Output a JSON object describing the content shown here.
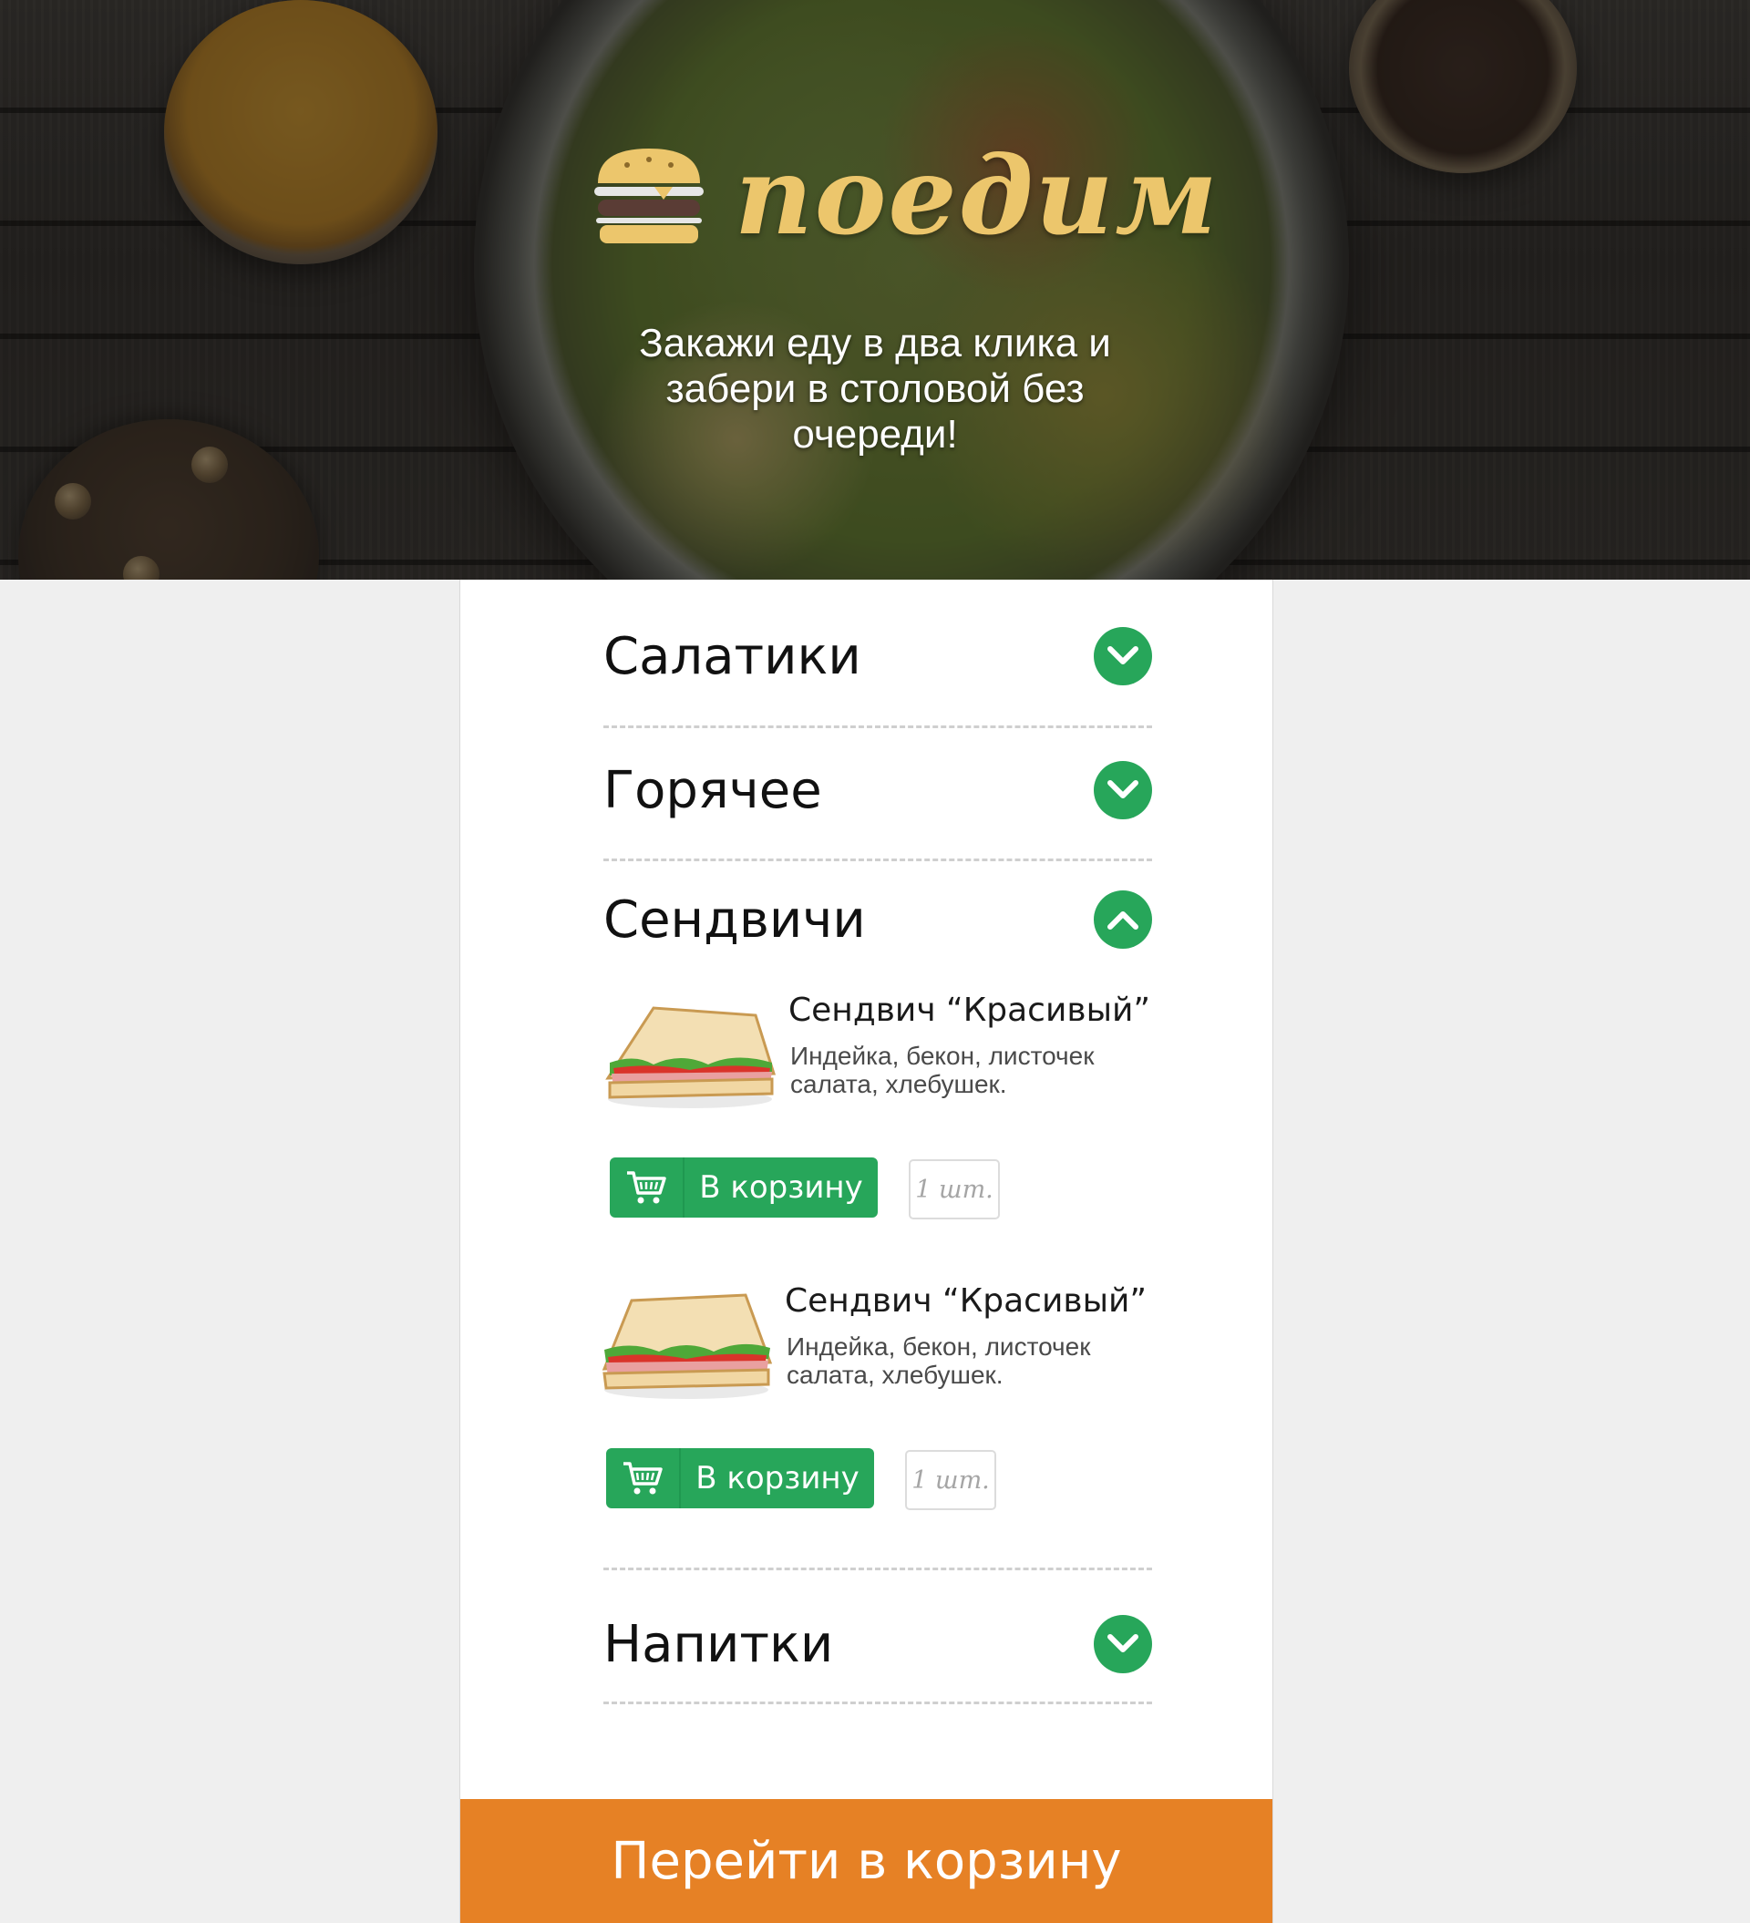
{
  "header": {
    "brand": "поедим",
    "tagline": "Закажи еду в два клика и забери в столовой без очереди!"
  },
  "menu": {
    "categories": [
      {
        "label": "Салатики",
        "state": "collapsed"
      },
      {
        "label": "Горячее",
        "state": "collapsed"
      },
      {
        "label": "Сендвичи",
        "state": "expanded"
      },
      {
        "label": "Напитки",
        "state": "collapsed"
      }
    ],
    "items": [
      {
        "title": "Сендвич “Красивый”",
        "description": "Индейка, бекон, листочек салата, хлебушек.",
        "add_label": "В корзину",
        "qty_placeholder": "1 шт."
      },
      {
        "title": "Сендвич “Красивый”",
        "description": "Индейка, бекон, листочек салата, хлебушек.",
        "add_label": "В корзину",
        "qty_placeholder": "1 шт."
      }
    ]
  },
  "footer": {
    "checkout_label": "Перейти в корзину"
  },
  "colors": {
    "accent_green": "#27a65a",
    "checkout_orange": "#e68125",
    "logo_yellow": "#ecc66c"
  },
  "icons": [
    "burger-logo-icon",
    "chevron-down-icon",
    "chevron-up-icon",
    "cart-icon"
  ]
}
